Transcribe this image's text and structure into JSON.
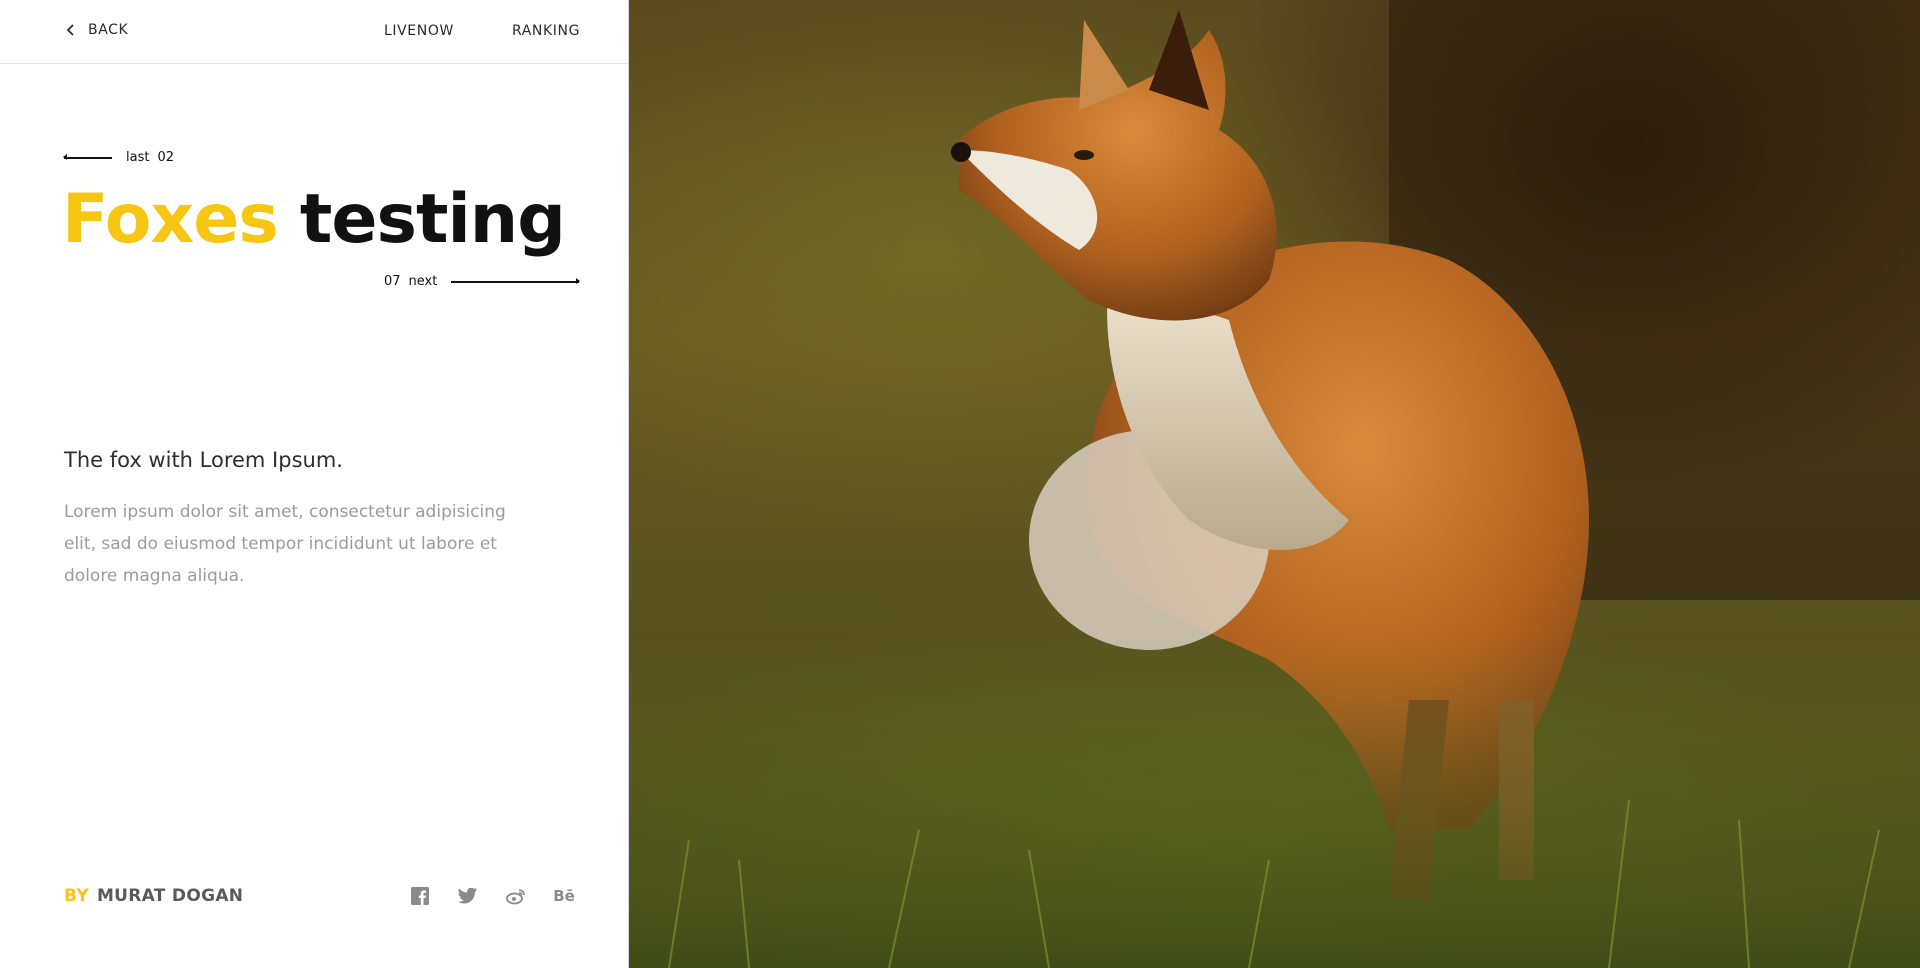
{
  "nav": {
    "back_label": "BACK",
    "livenow_label": "LIVENOW",
    "ranking_label": "RANKING"
  },
  "pager": {
    "last_label": "last",
    "last_number": "02",
    "next_number": "07",
    "next_label": "next"
  },
  "hero": {
    "title_accent": "Foxes",
    "title_rest": "testing",
    "subtitle": "The fox with Lorem Ipsum.",
    "body": "Lorem ipsum dolor sit amet, consectetur adipisicing elit, sad do eiusmod tempor incididunt ut labore et dolore magna aliqua."
  },
  "author": {
    "by_label": "BY",
    "name": "MURAT DOGAN"
  },
  "socials": [
    {
      "icon": "facebook-icon"
    },
    {
      "icon": "twitter-icon"
    },
    {
      "icon": "weibo-icon"
    },
    {
      "icon": "behance-icon",
      "text": "Bē"
    }
  ],
  "colors": {
    "accent": "#f7c613",
    "text_dark": "#111111",
    "text_muted": "#9b9b9b"
  }
}
